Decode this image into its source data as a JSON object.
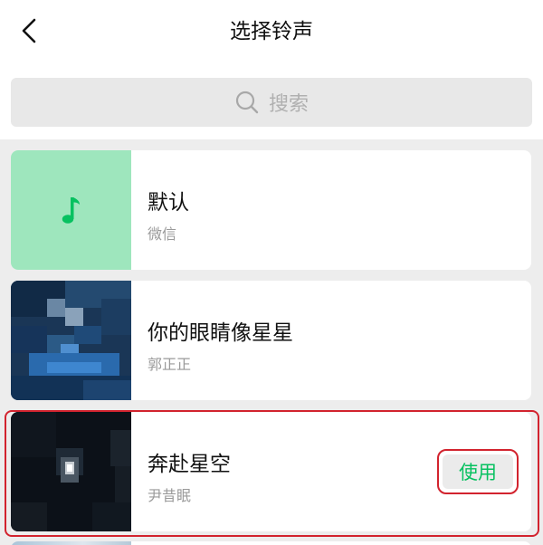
{
  "header": {
    "title": "选择铃声",
    "back_icon": "chevron-left-icon"
  },
  "search": {
    "icon": "search-icon",
    "placeholder": "搜索"
  },
  "ringtones": [
    {
      "name": "默认",
      "artist": "微信",
      "thumb": "music-note-icon",
      "thumb_color": "#9ee6bd",
      "note_color": "#07c160"
    },
    {
      "name": "你的眼睛像星星",
      "artist": "郭正正",
      "thumb": "pixelated-cover"
    },
    {
      "name": "奔赴星空",
      "artist": "尹昔眠",
      "thumb": "pixelated-cover",
      "selected": true,
      "action_label": "使用"
    }
  ],
  "colors": {
    "accent_green": "#07c160",
    "highlight_red": "#d2232e"
  }
}
